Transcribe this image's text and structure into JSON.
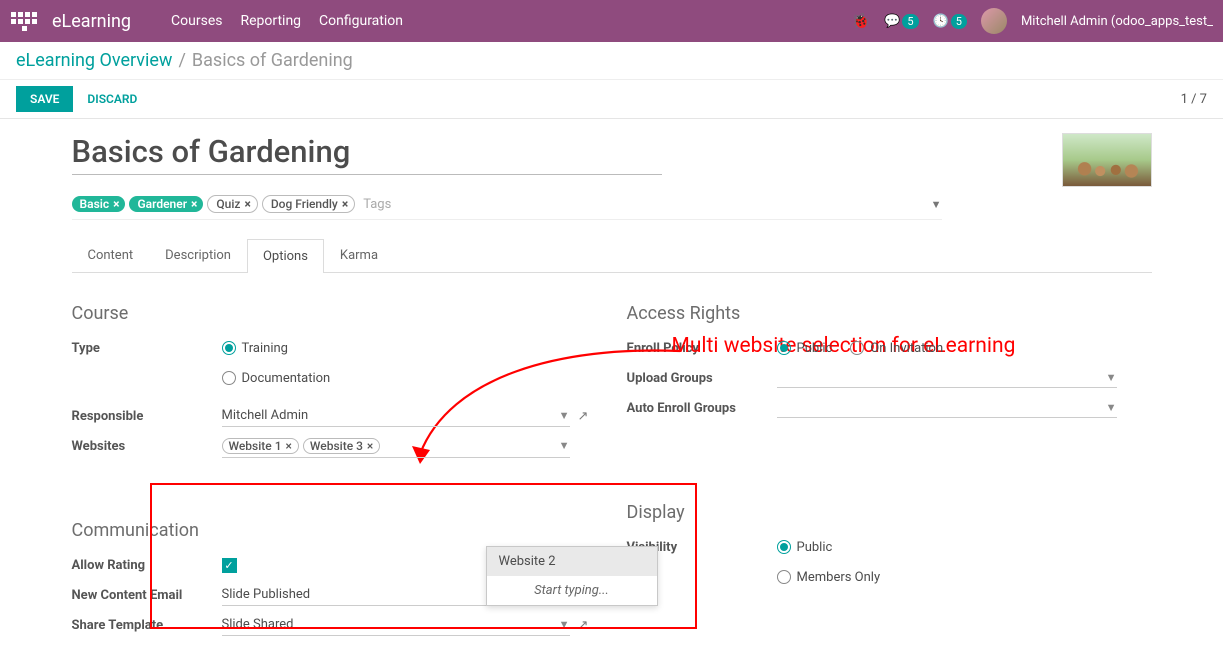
{
  "nav": {
    "brand": "eLearning",
    "links": [
      "Courses",
      "Reporting",
      "Configuration"
    ],
    "msg_count": "5",
    "activity_count": "5",
    "user": "Mitchell Admin (odoo_apps_test_"
  },
  "breadcrumb": {
    "root": "eLearning Overview",
    "current": "Basics of Gardening"
  },
  "actions": {
    "save": "SAVE",
    "discard": "DISCARD",
    "pager": "1 / 7"
  },
  "form": {
    "title": "Basics of Gardening",
    "tags": {
      "green": [
        "Basic",
        "Gardener"
      ],
      "outline": [
        "Quiz",
        "Dog Friendly"
      ],
      "placeholder": "Tags"
    },
    "tabs": [
      "Content",
      "Description",
      "Options",
      "Karma"
    ],
    "active_tab": "Options"
  },
  "annotation": "Multi website selection for eLearning",
  "course": {
    "title": "Course",
    "type_label": "Type",
    "type_opts": [
      "Training",
      "Documentation"
    ],
    "responsible_label": "Responsible",
    "responsible_val": "Mitchell Admin",
    "websites_label": "Websites",
    "websites_tags": [
      "Website 1",
      "Website 3"
    ],
    "dropdown": {
      "opt": "Website 2",
      "hint": "Start typing..."
    }
  },
  "comm": {
    "title": "Communication",
    "allow_label": "Allow Rating",
    "newc_label": "New Content Email",
    "newc_val": "Slide Published",
    "share_label": "Share Template",
    "share_val": "Slide Shared"
  },
  "access": {
    "title": "Access Rights",
    "enroll_label": "Enroll Policy",
    "enroll_opts": [
      "Public",
      "On Invitation"
    ],
    "upload_label": "Upload Groups",
    "autoenroll_label": "Auto Enroll Groups"
  },
  "display": {
    "title": "Display",
    "vis_label": "Visibility",
    "vis_opts": [
      "Public",
      "Members Only"
    ]
  }
}
